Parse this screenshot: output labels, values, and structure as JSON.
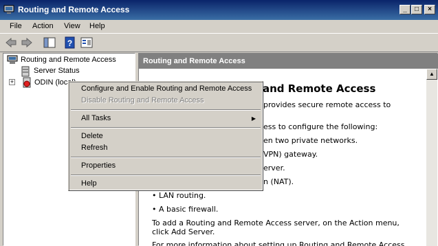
{
  "window": {
    "title": "Routing and Remote Access",
    "minimize": "_",
    "maximize": "□",
    "close": "×"
  },
  "menu": [
    "File",
    "Action",
    "View",
    "Help"
  ],
  "tree": {
    "root": "Routing and Remote Access",
    "items": [
      {
        "label": "Server Status",
        "expander": ""
      },
      {
        "label": "ODIN (local)",
        "expander": "+"
      }
    ]
  },
  "right_pane": {
    "header": "Routing and Remote Access",
    "heading": "and Remote Access",
    "lines": [
      "provides secure remote access to",
      "ess to configure the following:",
      "en two private networks.",
      "VPN) gateway.",
      "erver.",
      "n (NAT).",
      "• LAN routing.",
      "• A basic firewall.",
      "To add a Routing and Remote Access server, on the Action menu,",
      "click Add Server.",
      "For more information about setting up Routing and Remote Access"
    ]
  },
  "context_menu": {
    "items": [
      {
        "label": "Configure and Enable Routing and Remote Access",
        "disabled": false
      },
      {
        "label": "Disable Routing and Remote Access",
        "disabled": true
      },
      {
        "label": "All Tasks",
        "submenu": true
      },
      {
        "label": "Delete"
      },
      {
        "label": "Refresh"
      },
      {
        "label": "Properties"
      },
      {
        "label": "Help"
      }
    ],
    "submenu_arrow": "▶"
  },
  "colors": {
    "titlebar_start": "#0a246a",
    "titlebar_end": "#3a6ea5",
    "header_bg": "#808080",
    "face": "#d4d0c8"
  }
}
